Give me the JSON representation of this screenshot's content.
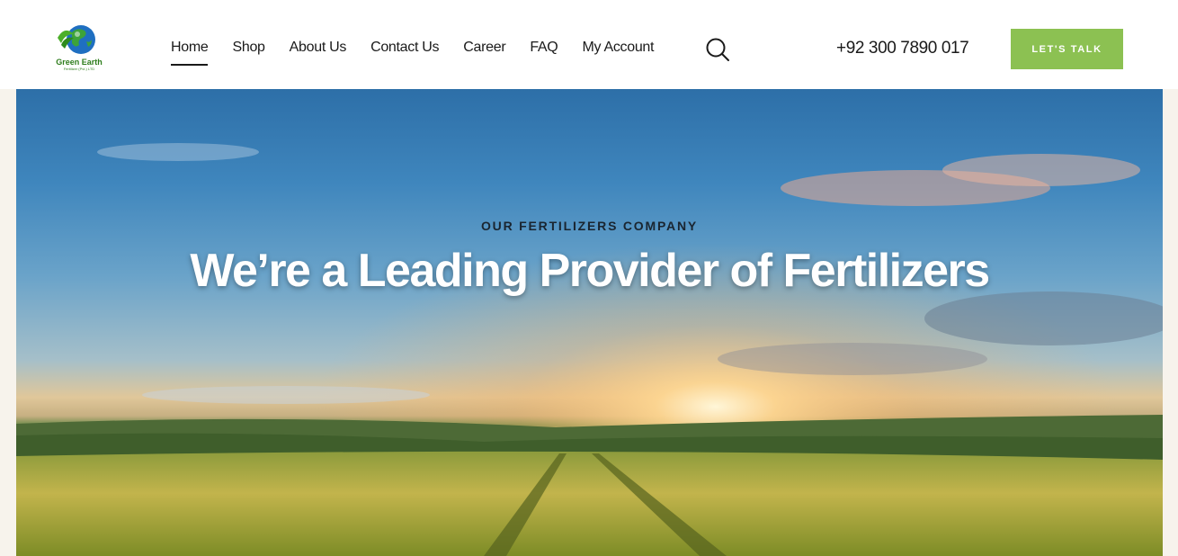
{
  "header": {
    "logo": {
      "name": "Green Earth",
      "subtitle": "Fertilizer (Pvt.) LTD"
    },
    "nav": [
      {
        "label": "Home",
        "active": true
      },
      {
        "label": "Shop"
      },
      {
        "label": "About Us"
      },
      {
        "label": "Contact Us"
      },
      {
        "label": "Career"
      },
      {
        "label": "FAQ"
      },
      {
        "label": "My Account"
      }
    ],
    "search_icon": "search-icon",
    "phone": "+92 300 7890 017",
    "cta_label": "LET'S TALK"
  },
  "hero": {
    "eyebrow": "OUR FERTILIZERS COMPANY",
    "headline": "We’re a Leading Provider of Fertilizers"
  },
  "colors": {
    "accent": "#8cc152",
    "text": "#1a1a1a",
    "background": "#f7f3ec"
  }
}
